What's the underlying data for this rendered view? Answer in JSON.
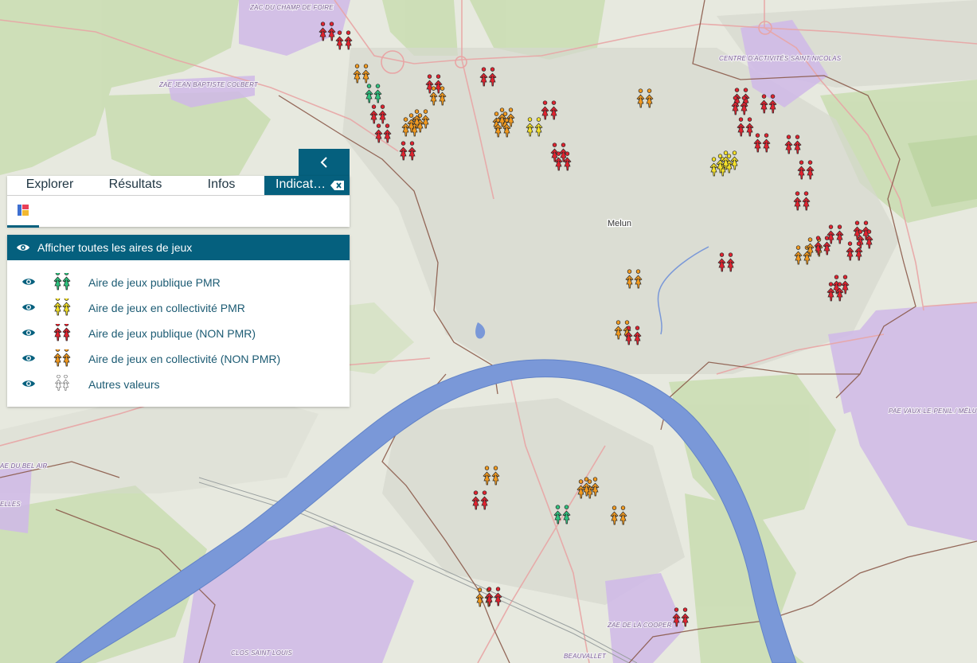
{
  "map": {
    "city_label": "Melun",
    "zone_labels": {
      "champ_de_foire": "ZAC DU CHAMP DE FOIRE",
      "colbert": "ZAE JEAN BAPTISTE COLBERT",
      "saint_nicolas": "CENTRE D'ACTIVITÉS SAINT NICOLAS",
      "vaux_le_penil": "PAE VAUX-LE-PENIL / MÉLU",
      "bel_air": "AE DU BEL AIR",
      "elles": "ELLES",
      "cooper": "ZAE DE LA COOPER",
      "clos_saint_louis": "CLOS SAINT LOUIS",
      "beauvallet": "BEAUVALLET"
    },
    "colors": {
      "publique_pmr": "#2ec27e",
      "collectivite_pmr": "#f4e12a",
      "publique_non_pmr": "#e0232f",
      "collectivite_non_pmr": "#f29a1f",
      "autres": "#ffffff",
      "panel_accent": "#05607e",
      "water": "#6b8fd6",
      "zone": "#cdb6e6",
      "forest": "#c7dcae"
    }
  },
  "panel": {
    "tabs": [
      {
        "label": "Explorer"
      },
      {
        "label": "Résultats"
      },
      {
        "label": "Infos"
      },
      {
        "label": "Indicat…"
      }
    ],
    "collapse_icon": "chevron-left-icon",
    "close_icon": "backspace-icon",
    "subtab_icon": "legend-icon"
  },
  "legend": {
    "header": "Afficher toutes les aires de jeux",
    "items": [
      {
        "label": "Aire de jeux publique PMR",
        "color": "#2ec27e"
      },
      {
        "label": "Aire de jeux en collectivité PMR",
        "color": "#f4e12a"
      },
      {
        "label": "Aire de jeux publique (NON PMR)",
        "color": "#e0232f"
      },
      {
        "label": "Aire de jeux en collectivité (NON PMR)",
        "color": "#f29a1f"
      },
      {
        "label": "Autres valeurs",
        "color": "#ffffff"
      }
    ]
  }
}
